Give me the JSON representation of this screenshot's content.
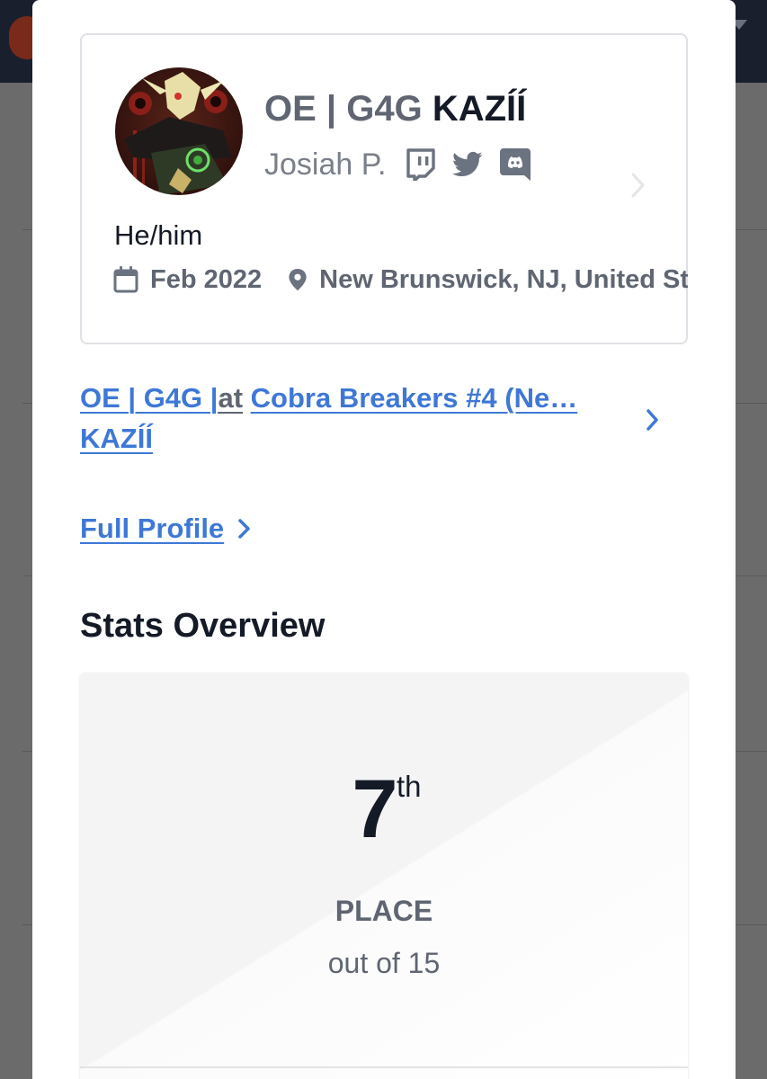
{
  "profile": {
    "prefix": "OE | G4G",
    "gamertag": "KAZÍÍ",
    "real_name": "Josiah P.",
    "social_icons": [
      "twitch-icon",
      "twitter-icon",
      "discord-icon"
    ],
    "pronouns": "He/him",
    "joined": "Feb 2022",
    "location": "New Brunswick, NJ, United States"
  },
  "event": {
    "player_prefix": "OE | G4G |",
    "player_tag": "KAZÍÍ",
    "connector": "at",
    "name": "Cobra Breakers #4 (Ne…"
  },
  "full_profile": {
    "label": "Full Profile"
  },
  "stats": {
    "title": "Stats Overview",
    "placement": "7",
    "ordinal_suffix": "th",
    "place_label": "PLACE",
    "total_label": "out of 15"
  },
  "colors": {
    "link": "#3e78d6",
    "muted": "#5f6672",
    "text": "#141a26",
    "header_bg": "#1a1f2e"
  }
}
